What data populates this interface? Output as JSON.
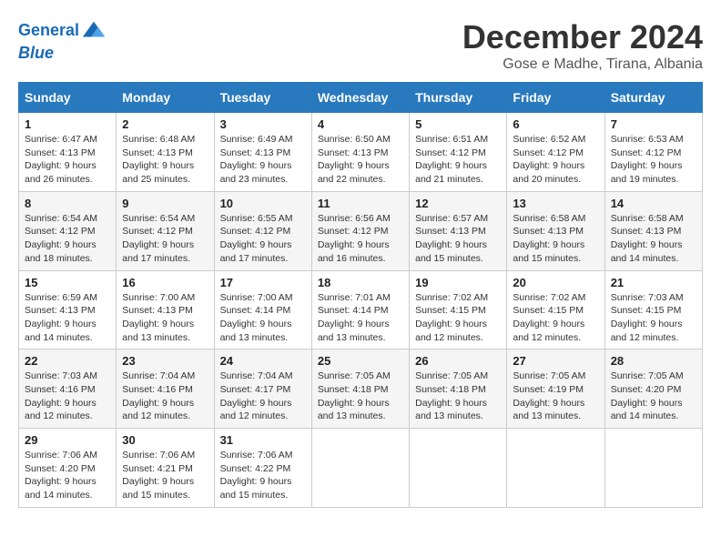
{
  "header": {
    "logo_line1": "General",
    "logo_line2": "Blue",
    "month": "December 2024",
    "location": "Gose e Madhe, Tirana, Albania"
  },
  "days_of_week": [
    "Sunday",
    "Monday",
    "Tuesday",
    "Wednesday",
    "Thursday",
    "Friday",
    "Saturday"
  ],
  "weeks": [
    [
      {
        "day": "1",
        "sunrise": "6:47 AM",
        "sunset": "4:13 PM",
        "daylight": "9 hours and 26 minutes."
      },
      {
        "day": "2",
        "sunrise": "6:48 AM",
        "sunset": "4:13 PM",
        "daylight": "9 hours and 25 minutes."
      },
      {
        "day": "3",
        "sunrise": "6:49 AM",
        "sunset": "4:13 PM",
        "daylight": "9 hours and 23 minutes."
      },
      {
        "day": "4",
        "sunrise": "6:50 AM",
        "sunset": "4:13 PM",
        "daylight": "9 hours and 22 minutes."
      },
      {
        "day": "5",
        "sunrise": "6:51 AM",
        "sunset": "4:12 PM",
        "daylight": "9 hours and 21 minutes."
      },
      {
        "day": "6",
        "sunrise": "6:52 AM",
        "sunset": "4:12 PM",
        "daylight": "9 hours and 20 minutes."
      },
      {
        "day": "7",
        "sunrise": "6:53 AM",
        "sunset": "4:12 PM",
        "daylight": "9 hours and 19 minutes."
      }
    ],
    [
      {
        "day": "8",
        "sunrise": "6:54 AM",
        "sunset": "4:12 PM",
        "daylight": "9 hours and 18 minutes."
      },
      {
        "day": "9",
        "sunrise": "6:54 AM",
        "sunset": "4:12 PM",
        "daylight": "9 hours and 17 minutes."
      },
      {
        "day": "10",
        "sunrise": "6:55 AM",
        "sunset": "4:12 PM",
        "daylight": "9 hours and 17 minutes."
      },
      {
        "day": "11",
        "sunrise": "6:56 AM",
        "sunset": "4:12 PM",
        "daylight": "9 hours and 16 minutes."
      },
      {
        "day": "12",
        "sunrise": "6:57 AM",
        "sunset": "4:13 PM",
        "daylight": "9 hours and 15 minutes."
      },
      {
        "day": "13",
        "sunrise": "6:58 AM",
        "sunset": "4:13 PM",
        "daylight": "9 hours and 15 minutes."
      },
      {
        "day": "14",
        "sunrise": "6:58 AM",
        "sunset": "4:13 PM",
        "daylight": "9 hours and 14 minutes."
      }
    ],
    [
      {
        "day": "15",
        "sunrise": "6:59 AM",
        "sunset": "4:13 PM",
        "daylight": "9 hours and 14 minutes."
      },
      {
        "day": "16",
        "sunrise": "7:00 AM",
        "sunset": "4:13 PM",
        "daylight": "9 hours and 13 minutes."
      },
      {
        "day": "17",
        "sunrise": "7:00 AM",
        "sunset": "4:14 PM",
        "daylight": "9 hours and 13 minutes."
      },
      {
        "day": "18",
        "sunrise": "7:01 AM",
        "sunset": "4:14 PM",
        "daylight": "9 hours and 13 minutes."
      },
      {
        "day": "19",
        "sunrise": "7:02 AM",
        "sunset": "4:15 PM",
        "daylight": "9 hours and 12 minutes."
      },
      {
        "day": "20",
        "sunrise": "7:02 AM",
        "sunset": "4:15 PM",
        "daylight": "9 hours and 12 minutes."
      },
      {
        "day": "21",
        "sunrise": "7:03 AM",
        "sunset": "4:15 PM",
        "daylight": "9 hours and 12 minutes."
      }
    ],
    [
      {
        "day": "22",
        "sunrise": "7:03 AM",
        "sunset": "4:16 PM",
        "daylight": "9 hours and 12 minutes."
      },
      {
        "day": "23",
        "sunrise": "7:04 AM",
        "sunset": "4:16 PM",
        "daylight": "9 hours and 12 minutes."
      },
      {
        "day": "24",
        "sunrise": "7:04 AM",
        "sunset": "4:17 PM",
        "daylight": "9 hours and 12 minutes."
      },
      {
        "day": "25",
        "sunrise": "7:05 AM",
        "sunset": "4:18 PM",
        "daylight": "9 hours and 13 minutes."
      },
      {
        "day": "26",
        "sunrise": "7:05 AM",
        "sunset": "4:18 PM",
        "daylight": "9 hours and 13 minutes."
      },
      {
        "day": "27",
        "sunrise": "7:05 AM",
        "sunset": "4:19 PM",
        "daylight": "9 hours and 13 minutes."
      },
      {
        "day": "28",
        "sunrise": "7:05 AM",
        "sunset": "4:20 PM",
        "daylight": "9 hours and 14 minutes."
      }
    ],
    [
      {
        "day": "29",
        "sunrise": "7:06 AM",
        "sunset": "4:20 PM",
        "daylight": "9 hours and 14 minutes."
      },
      {
        "day": "30",
        "sunrise": "7:06 AM",
        "sunset": "4:21 PM",
        "daylight": "9 hours and 15 minutes."
      },
      {
        "day": "31",
        "sunrise": "7:06 AM",
        "sunset": "4:22 PM",
        "daylight": "9 hours and 15 minutes."
      },
      null,
      null,
      null,
      null
    ]
  ],
  "labels": {
    "sunrise": "Sunrise:",
    "sunset": "Sunset:",
    "daylight": "Daylight:"
  }
}
